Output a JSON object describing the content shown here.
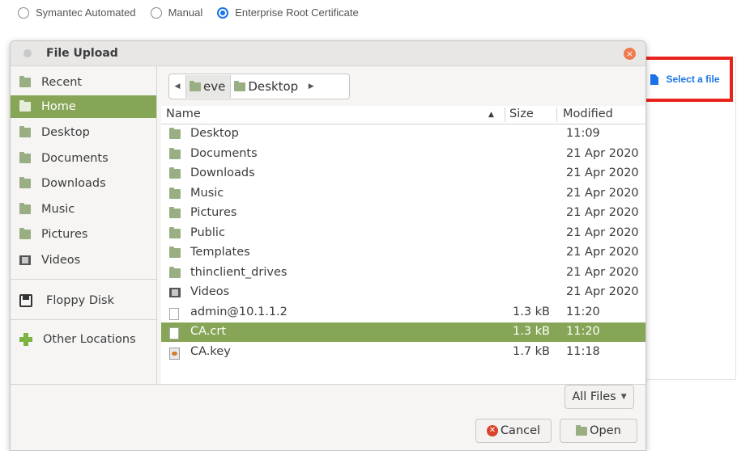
{
  "radios": [
    {
      "label": "Symantec Automated",
      "selected": false
    },
    {
      "label": "Manual",
      "selected": false
    },
    {
      "label": "Enterprise Root Certificate",
      "selected": true
    }
  ],
  "select_file": {
    "label": "Select a file"
  },
  "dialog": {
    "title": "File Upload",
    "close_icon": "×",
    "sidebar": {
      "items": [
        {
          "label": "Recent",
          "icon": "folder-icon"
        },
        {
          "label": "Home",
          "icon": "home-folder-icon",
          "selected": true
        },
        {
          "label": "Desktop",
          "icon": "folder-icon"
        },
        {
          "label": "Documents",
          "icon": "folder-icon"
        },
        {
          "label": "Downloads",
          "icon": "folder-icon"
        },
        {
          "label": "Music",
          "icon": "folder-icon"
        },
        {
          "label": "Pictures",
          "icon": "folder-icon"
        },
        {
          "label": "Videos",
          "icon": "videos-folder-icon"
        }
      ],
      "floppy": {
        "label": "Floppy Disk"
      },
      "other": {
        "label": "Other Locations"
      }
    },
    "pathbar": {
      "back": "◀",
      "forward": "▶",
      "crumbs": [
        {
          "label": "eve",
          "active": true
        },
        {
          "label": "Desktop",
          "active": false
        }
      ]
    },
    "columns": {
      "name": "Name",
      "sort_indicator": "▲",
      "size": "Size",
      "modified": "Modified"
    },
    "files": [
      {
        "name": "Desktop",
        "size": "",
        "modified": "11:09",
        "kind": "folder"
      },
      {
        "name": "Documents",
        "size": "",
        "modified": "21 Apr 2020",
        "kind": "folder"
      },
      {
        "name": "Downloads",
        "size": "",
        "modified": "21 Apr 2020",
        "kind": "folder"
      },
      {
        "name": "Music",
        "size": "",
        "modified": "21 Apr 2020",
        "kind": "folder"
      },
      {
        "name": "Pictures",
        "size": "",
        "modified": "21 Apr 2020",
        "kind": "folder"
      },
      {
        "name": "Public",
        "size": "",
        "modified": "21 Apr 2020",
        "kind": "folder"
      },
      {
        "name": "Templates",
        "size": "",
        "modified": "21 Apr 2020",
        "kind": "folder"
      },
      {
        "name": "thinclient_drives",
        "size": "",
        "modified": "21 Apr 2020",
        "kind": "folder"
      },
      {
        "name": "Videos",
        "size": "",
        "modified": "21 Apr 2020",
        "kind": "videos"
      },
      {
        "name": "admin@10.1.1.2",
        "size": "1.3 kB",
        "modified": "11:20",
        "kind": "file"
      },
      {
        "name": "CA.crt",
        "size": "1.3 kB",
        "modified": "11:20",
        "kind": "file",
        "selected": true
      },
      {
        "name": "CA.key",
        "size": "1.7 kB",
        "modified": "11:18",
        "kind": "key"
      }
    ],
    "filter": {
      "label": "All Files",
      "caret": "▼"
    },
    "buttons": {
      "cancel": "Cancel",
      "open": "Open"
    }
  },
  "colors": {
    "accent_selection": "#87a556",
    "radio_active": "#1a73e8",
    "highlight_box": "#e8231c",
    "close_button": "#ee7a4e"
  }
}
